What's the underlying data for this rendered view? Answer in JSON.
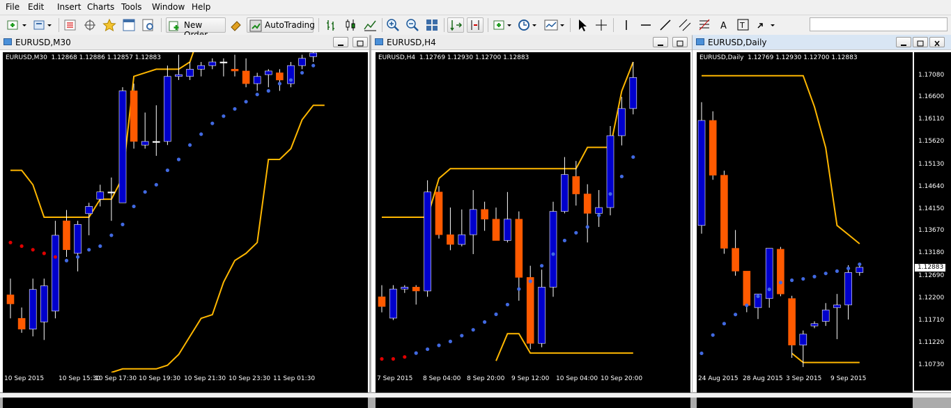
{
  "menu": [
    "File",
    "Edit",
    "Insert",
    "Charts",
    "Tools",
    "Window",
    "Help"
  ],
  "toolbar": {
    "new_order_label": "New Order",
    "autotrading_label": "AutoTrading",
    "search_placeholder": "",
    "icons": [
      "new-chart-icon",
      "profiles-icon",
      "market-watch-icon",
      "navigator-icon",
      "favorites-icon",
      "data-window-icon",
      "strategy-tester-icon",
      "new-order-icon",
      "metaeditor-icon",
      "autotrading-icon",
      "bar-chart-icon",
      "candlestick-icon",
      "line-chart-icon",
      "zoom-in-icon",
      "zoom-out-icon",
      "tile-windows-icon",
      "auto-scroll-icon",
      "chart-shift-icon",
      "indicators-icon",
      "periods-icon",
      "templates-icon",
      "cursor-icon",
      "crosshair-icon",
      "vertical-line-icon",
      "horizontal-line-icon",
      "trendline-icon",
      "equidistant-channel-icon",
      "fibonacci-icon",
      "text-icon",
      "text-label-icon",
      "arrows-icon"
    ]
  },
  "colors": {
    "bull": "#0000cc",
    "bear": "#ff5a00",
    "envelope": "#ffb700",
    "sar_up": "#4169e1",
    "sar_down": "#e00000",
    "bg": "#000000",
    "axis_text": "#ffffff"
  },
  "windows": [
    {
      "title": "EURUSD,M30",
      "info": "EURUSD,M30  1.12868 1.12886 1.12857 1.12883",
      "time_labels": [
        "10 Sep 2015",
        "10 Sep 15:30",
        "10 Sep 17:30",
        "10 Sep 19:30",
        "10 Sep 21:30",
        "10 Sep 23:30",
        "11 Sep 01:30"
      ],
      "chart_data": {
        "type": "candlestick",
        "price_min": 1.1222,
        "price_max": 1.1308,
        "candles": [
          {
            "o": 1.12435,
            "h": 1.1248,
            "l": 1.1237,
            "c": 1.1241
          },
          {
            "o": 1.1237,
            "h": 1.124,
            "l": 1.1233,
            "c": 1.1234
          },
          {
            "o": 1.1234,
            "h": 1.1248,
            "l": 1.1232,
            "c": 1.1245
          },
          {
            "o": 1.1236,
            "h": 1.1248,
            "l": 1.1231,
            "c": 1.1246
          },
          {
            "o": 1.1239,
            "h": 1.1264,
            "l": 1.1237,
            "c": 1.126
          },
          {
            "o": 1.1264,
            "h": 1.1267,
            "l": 1.1254,
            "c": 1.1256
          },
          {
            "o": 1.1255,
            "h": 1.1264,
            "l": 1.125,
            "c": 1.1263
          },
          {
            "o": 1.1266,
            "h": 1.1269,
            "l": 1.126,
            "c": 1.1268
          },
          {
            "o": 1.127,
            "h": 1.1274,
            "l": 1.1268,
            "c": 1.1272
          },
          {
            "o": 1.1272,
            "h": 1.1276,
            "l": 1.1264,
            "c": 1.1272
          },
          {
            "o": 1.1269,
            "h": 1.1301,
            "l": 1.1269,
            "c": 1.13
          },
          {
            "o": 1.13,
            "h": 1.1302,
            "l": 1.1284,
            "c": 1.1286
          },
          {
            "o": 1.1285,
            "h": 1.1294,
            "l": 1.1284,
            "c": 1.1286
          },
          {
            "o": 1.1286,
            "h": 1.1296,
            "l": 1.1282,
            "c": 1.1286
          },
          {
            "o": 1.1286,
            "h": 1.1307,
            "l": 1.1285,
            "c": 1.1304
          },
          {
            "o": 1.1304,
            "h": 1.131,
            "l": 1.1303,
            "c": 1.13045
          },
          {
            "o": 1.1304,
            "h": 1.1308,
            "l": 1.1303,
            "c": 1.1306
          },
          {
            "o": 1.1306,
            "h": 1.1308,
            "l": 1.1304,
            "c": 1.1307
          },
          {
            "o": 1.1307,
            "h": 1.1309,
            "l": 1.1306,
            "c": 1.1308
          },
          {
            "o": 1.1308,
            "h": 1.1309,
            "l": 1.1304,
            "c": 1.1308
          },
          {
            "o": 1.1306,
            "h": 1.131,
            "l": 1.1304,
            "c": 1.13055
          },
          {
            "o": 1.13055,
            "h": 1.1309,
            "l": 1.1301,
            "c": 1.1302
          },
          {
            "o": 1.1302,
            "h": 1.1305,
            "l": 1.13,
            "c": 1.1304
          },
          {
            "o": 1.13045,
            "h": 1.1306,
            "l": 1.1301,
            "c": 1.13055
          },
          {
            "o": 1.1305,
            "h": 1.1306,
            "l": 1.13,
            "c": 1.1303
          },
          {
            "o": 1.1302,
            "h": 1.1308,
            "l": 1.1301,
            "c": 1.1307
          },
          {
            "o": 1.1307,
            "h": 1.131,
            "l": 1.1306,
            "c": 1.1309
          },
          {
            "o": 1.13095,
            "h": 1.1311,
            "l": 1.1308,
            "c": 1.13105
          }
        ],
        "envelope_upper": [
          1.1278,
          1.1278,
          1.1274,
          1.1265,
          1.1265,
          1.1265,
          1.1265,
          1.1265,
          1.127,
          1.127,
          1.1276,
          1.1304,
          1.1305,
          1.1306,
          1.1306,
          1.1306,
          1.1308,
          1.1317,
          1.1317,
          1.1317,
          1.1317,
          1.1317,
          1.1317,
          1.1317,
          1.1317,
          1.1317,
          1.1315,
          1.1316
        ],
        "envelope_lower": [
          null,
          null,
          null,
          null,
          null,
          null,
          null,
          null,
          null,
          1.1222,
          1.1223,
          1.1223,
          1.1223,
          1.1223,
          1.1224,
          1.1227,
          1.1232,
          1.1237,
          1.1238,
          1.1247,
          1.1253,
          1.1255,
          1.1258,
          1.1281,
          1.1281,
          1.1284,
          1.1292,
          1.1296,
          1.1296
        ],
        "sar": [
          1.1258,
          1.1257,
          1.1256,
          1.1255,
          1.1254,
          1.1253,
          1.1254,
          1.1256,
          1.1257,
          1.126,
          1.1263,
          1.1268,
          1.1272,
          1.1274,
          1.1278,
          1.1281,
          1.1285,
          1.1288,
          1.1291,
          1.1293,
          1.1295,
          1.1297,
          1.1299,
          1.13,
          1.1302,
          1.1303,
          1.1305,
          1.1307
        ],
        "sar_down_count": 5
      }
    },
    {
      "title": "EURUSD,H4",
      "info": "EURUSD,H4  1.12769 1.12930 1.12700 1.12883",
      "time_labels": [
        "7 Sep 2015",
        "8 Sep 04:00",
        "8 Sep 20:00",
        "9 Sep 12:00",
        "10 Sep 04:00",
        "10 Sep 20:00"
      ],
      "chart_data": {
        "type": "candlestick",
        "price_min": 1.1125,
        "price_max": 1.1285,
        "candles": [
          {
            "o": 1.1164,
            "h": 1.117,
            "l": 1.1156,
            "c": 1.1159
          },
          {
            "o": 1.1153,
            "h": 1.117,
            "l": 1.1152,
            "c": 1.1168
          },
          {
            "o": 1.1168,
            "h": 1.117,
            "l": 1.1166,
            "c": 1.1169
          },
          {
            "o": 1.1169,
            "h": 1.117,
            "l": 1.116,
            "c": 1.1167
          },
          {
            "o": 1.1167,
            "h": 1.1224,
            "l": 1.1164,
            "c": 1.1218
          },
          {
            "o": 1.1218,
            "h": 1.1221,
            "l": 1.1194,
            "c": 1.1196
          },
          {
            "o": 1.1196,
            "h": 1.121,
            "l": 1.1188,
            "c": 1.1191
          },
          {
            "o": 1.1191,
            "h": 1.1209,
            "l": 1.119,
            "c": 1.1196
          },
          {
            "o": 1.1196,
            "h": 1.1219,
            "l": 1.1186,
            "c": 1.1209
          },
          {
            "o": 1.1209,
            "h": 1.1213,
            "l": 1.1198,
            "c": 1.1204
          },
          {
            "o": 1.1204,
            "h": 1.121,
            "l": 1.1193,
            "c": 1.1193
          },
          {
            "o": 1.1193,
            "h": 1.1218,
            "l": 1.1192,
            "c": 1.1204
          },
          {
            "o": 1.1204,
            "h": 1.1208,
            "l": 1.1162,
            "c": 1.1174
          },
          {
            "o": 1.1174,
            "h": 1.118,
            "l": 1.1137,
            "c": 1.114
          },
          {
            "o": 1.114,
            "h": 1.1178,
            "l": 1.1138,
            "c": 1.1169
          },
          {
            "o": 1.1169,
            "h": 1.1213,
            "l": 1.1164,
            "c": 1.1208
          },
          {
            "o": 1.1208,
            "h": 1.1236,
            "l": 1.1207,
            "c": 1.1227
          },
          {
            "o": 1.1226,
            "h": 1.1234,
            "l": 1.1211,
            "c": 1.1217
          },
          {
            "o": 1.1217,
            "h": 1.1222,
            "l": 1.1192,
            "c": 1.1207
          },
          {
            "o": 1.1207,
            "h": 1.1219,
            "l": 1.12,
            "c": 1.121
          },
          {
            "o": 1.121,
            "h": 1.1252,
            "l": 1.1206,
            "c": 1.1247
          },
          {
            "o": 1.1247,
            "h": 1.1267,
            "l": 1.1242,
            "c": 1.1261
          },
          {
            "o": 1.1261,
            "h": 1.1285,
            "l": 1.1258,
            "c": 1.1277
          }
        ],
        "envelope_upper": [
          1.1205,
          1.1205,
          1.1205,
          1.1205,
          1.1205,
          1.1225,
          1.123,
          1.123,
          1.123,
          1.123,
          1.123,
          1.123,
          1.123,
          1.123,
          1.123,
          1.123,
          1.123,
          1.123,
          1.1241,
          1.1241,
          1.1241,
          1.127,
          1.1285
        ],
        "envelope_lower": [
          null,
          null,
          null,
          null,
          null,
          null,
          null,
          null,
          null,
          null,
          1.1131,
          1.1145,
          1.1145,
          1.1135,
          1.1135,
          1.1135,
          1.1135,
          1.1135,
          1.1135,
          1.1135,
          1.1135,
          1.1135,
          1.1135
        ],
        "sar": [
          1.1132,
          1.1132,
          1.1133,
          1.1135,
          1.1137,
          1.1139,
          1.1141,
          1.1144,
          1.1147,
          1.1151,
          1.1155,
          1.116,
          1.1168,
          1.1172,
          1.118,
          1.1186,
          1.1193,
          1.1197,
          1.12,
          1.1206,
          1.1217,
          1.1226,
          1.1236
        ],
        "sar_down_count": 3
      }
    },
    {
      "title": "EURUSD,Daily",
      "info": "EURUSD,Daily  1.12769 1.12930 1.12700 1.12883",
      "current_price": "1.12883",
      "price_labels": [
        "1.17080",
        "1.16600",
        "1.16110",
        "1.15620",
        "1.15130",
        "1.14640",
        "1.14150",
        "1.13670",
        "1.13180",
        "1.12690",
        "1.12200",
        "1.11710",
        "1.11220",
        "1.10730"
      ],
      "time_labels": [
        "24 Aug 2015",
        "28 Aug 2015",
        "3 Sep 2015",
        "9 Sep 2015"
      ],
      "chart_data": {
        "type": "candlestick",
        "price_min": 1.1058,
        "price_max": 1.1735,
        "candles": [
          {
            "o": 1.138,
            "h": 1.165,
            "l": 1.1362,
            "c": 1.161
          },
          {
            "o": 1.161,
            "h": 1.163,
            "l": 1.148,
            "c": 1.149
          },
          {
            "o": 1.149,
            "h": 1.15,
            "l": 1.1318,
            "c": 1.133
          },
          {
            "o": 1.133,
            "h": 1.137,
            "l": 1.127,
            "c": 1.128
          },
          {
            "o": 1.128,
            "h": 1.128,
            "l": 1.119,
            "c": 1.1205
          },
          {
            "o": 1.12,
            "h": 1.122,
            "l": 1.1175,
            "c": 1.123
          },
          {
            "o": 1.122,
            "h": 1.133,
            "l": 1.12,
            "c": 1.133
          },
          {
            "o": 1.1328,
            "h": 1.1333,
            "l": 1.1225,
            "c": 1.123
          },
          {
            "o": 1.122,
            "h": 1.1226,
            "l": 1.109,
            "c": 1.1118
          },
          {
            "o": 1.1118,
            "h": 1.115,
            "l": 1.107,
            "c": 1.1142
          },
          {
            "o": 1.116,
            "h": 1.117,
            "l": 1.1155,
            "c": 1.1165
          },
          {
            "o": 1.117,
            "h": 1.121,
            "l": 1.116,
            "c": 1.1195
          },
          {
            "o": 1.12,
            "h": 1.123,
            "l": 1.1131,
            "c": 1.1206
          },
          {
            "o": 1.1206,
            "h": 1.1293,
            "l": 1.1174,
            "c": 1.1277
          },
          {
            "o": 1.1277,
            "h": 1.1293,
            "l": 1.127,
            "c": 1.12883
          }
        ],
        "envelope_upper": [
          1.1708,
          1.1708,
          1.1708,
          1.1708,
          1.1708,
          1.1708,
          1.1708,
          1.1708,
          1.1708,
          1.1708,
          1.164,
          1.155,
          1.138,
          1.136,
          1.134
        ],
        "envelope_lower": [
          null,
          null,
          null,
          null,
          null,
          null,
          null,
          null,
          1.11,
          1.108,
          1.108,
          1.108,
          1.108,
          1.108,
          1.108
        ],
        "sar": [
          1.11,
          1.114,
          1.1165,
          1.1185,
          1.1205,
          1.1225,
          1.124,
          1.1255,
          1.126,
          1.1263,
          1.1268,
          1.1275,
          1.128,
          1.1286,
          1.1295
        ],
        "sar_down_count": 0
      }
    }
  ]
}
